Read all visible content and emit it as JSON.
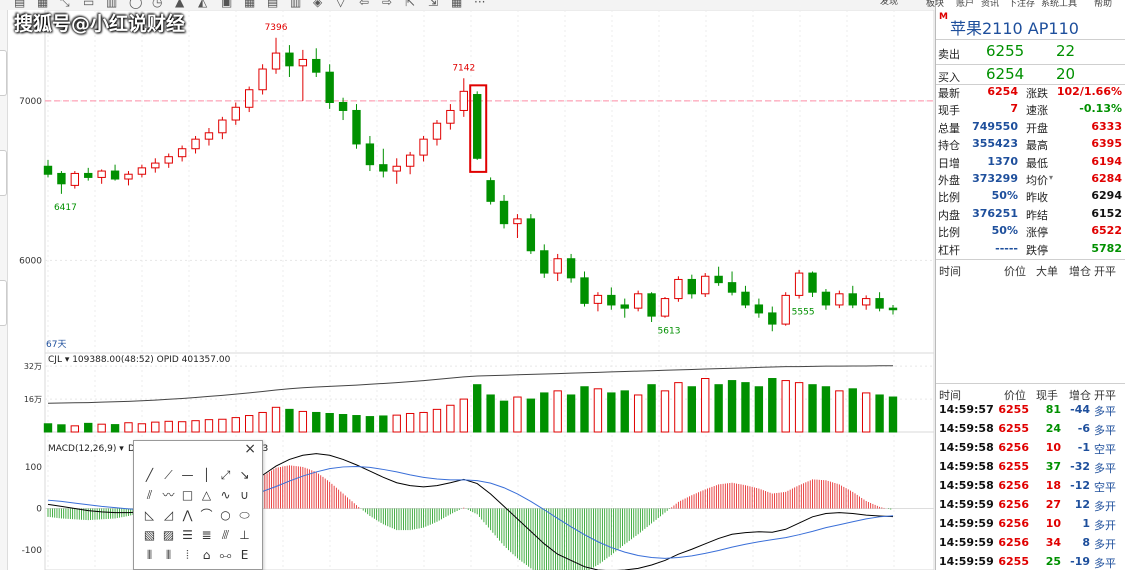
{
  "watermark": "搜狐号@小红说财经",
  "toolbar": {
    "icons": [
      "doc-icon",
      "grid-icon",
      "cursor-icon",
      "window-icon",
      "layout-icon",
      "circle-icon",
      "clock-icon",
      "chart-icon",
      "chart2-icon",
      "calendar-icon",
      "week-icon",
      "month-icon",
      "year-icon",
      "diamond-icon",
      "fold-icon",
      "back-icon",
      "forward-icon",
      "expand-icon",
      "shrink-icon",
      "table-icon",
      "more-icon"
    ],
    "more_label": "···",
    "right_label": "发现"
  },
  "chart_data": [
    {
      "type": "candlestick",
      "title": "",
      "period_label": "67天",
      "ylim": [
        5450,
        7520
      ],
      "yticks": [
        7000,
        6000
      ],
      "reference_line": 7000,
      "annotations": [
        {
          "label": "7396",
          "index": 17,
          "kind": "high"
        },
        {
          "label": "7142",
          "index": 31,
          "kind": "high"
        },
        {
          "label": "6417",
          "index": 1,
          "kind": "low"
        },
        {
          "label": "5613",
          "index": 46,
          "kind": "low"
        },
        {
          "label": "5555",
          "index": 56,
          "kind": "low"
        }
      ],
      "highlight_box_index": 32,
      "ohlc": [
        [
          6590,
          6630,
          6520,
          6540
        ],
        [
          6545,
          6560,
          6417,
          6480
        ],
        [
          6470,
          6560,
          6450,
          6545
        ],
        [
          6545,
          6580,
          6500,
          6520
        ],
        [
          6520,
          6570,
          6480,
          6560
        ],
        [
          6560,
          6600,
          6500,
          6510
        ],
        [
          6510,
          6560,
          6470,
          6540
        ],
        [
          6540,
          6600,
          6520,
          6580
        ],
        [
          6580,
          6640,
          6550,
          6610
        ],
        [
          6610,
          6670,
          6580,
          6650
        ],
        [
          6650,
          6720,
          6620,
          6700
        ],
        [
          6700,
          6780,
          6670,
          6760
        ],
        [
          6760,
          6830,
          6720,
          6800
        ],
        [
          6800,
          6900,
          6760,
          6880
        ],
        [
          6880,
          6990,
          6850,
          6960
        ],
        [
          6960,
          7090,
          6930,
          7070
        ],
        [
          7070,
          7230,
          7040,
          7200
        ],
        [
          7200,
          7396,
          7170,
          7300
        ],
        [
          7300,
          7350,
          7150,
          7220
        ],
        [
          7220,
          7320,
          7000,
          7260
        ],
        [
          7260,
          7330,
          7150,
          7180
        ],
        [
          7180,
          7230,
          6950,
          6990
        ],
        [
          6990,
          7020,
          6880,
          6940
        ],
        [
          6940,
          6980,
          6700,
          6730
        ],
        [
          6730,
          6780,
          6560,
          6600
        ],
        [
          6600,
          6700,
          6520,
          6560
        ],
        [
          6560,
          6640,
          6480,
          6590
        ],
        [
          6590,
          6680,
          6540,
          6660
        ],
        [
          6660,
          6780,
          6620,
          6760
        ],
        [
          6760,
          6880,
          6720,
          6860
        ],
        [
          6860,
          6980,
          6820,
          6940
        ],
        [
          6940,
          7142,
          6900,
          7060
        ],
        [
          7040,
          7060,
          6630,
          6640
        ],
        [
          6500,
          6520,
          6350,
          6370
        ],
        [
          6370,
          6410,
          6200,
          6230
        ],
        [
          6230,
          6290,
          6140,
          6260
        ],
        [
          6260,
          6290,
          6040,
          6060
        ],
        [
          6060,
          6100,
          5890,
          5920
        ],
        [
          5920,
          6040,
          5870,
          6010
        ],
        [
          6010,
          6040,
          5860,
          5890
        ],
        [
          5890,
          5930,
          5710,
          5730
        ],
        [
          5730,
          5800,
          5680,
          5780
        ],
        [
          5780,
          5830,
          5690,
          5720
        ],
        [
          5720,
          5760,
          5640,
          5700
        ],
        [
          5700,
          5810,
          5680,
          5790
        ],
        [
          5790,
          5800,
          5613,
          5650
        ],
        [
          5650,
          5770,
          5640,
          5760
        ],
        [
          5760,
          5900,
          5740,
          5880
        ],
        [
          5880,
          5910,
          5760,
          5790
        ],
        [
          5790,
          5920,
          5770,
          5900
        ],
        [
          5900,
          5960,
          5840,
          5860
        ],
        [
          5860,
          5930,
          5780,
          5800
        ],
        [
          5800,
          5840,
          5700,
          5720
        ],
        [
          5720,
          5760,
          5640,
          5670
        ],
        [
          5670,
          5710,
          5555,
          5600
        ],
        [
          5600,
          5800,
          5590,
          5780
        ],
        [
          5780,
          5940,
          5760,
          5920
        ],
        [
          5920,
          5930,
          5770,
          5800
        ],
        [
          5800,
          5820,
          5690,
          5720
        ],
        [
          5720,
          5810,
          5700,
          5790
        ],
        [
          5790,
          5840,
          5700,
          5720
        ],
        [
          5720,
          5780,
          5690,
          5760
        ],
        [
          5760,
          5800,
          5680,
          5700
        ],
        [
          5700,
          5720,
          5660,
          5690
        ]
      ]
    },
    {
      "type": "bar",
      "title": "",
      "series_label": "CJL",
      "readout": "109388.00(48:52)",
      "opid_readout": "OPID 401357.00",
      "yticks_labels": [
        "32万",
        "16万"
      ],
      "yticks": [
        320000,
        160000
      ],
      "ylim": [
        0,
        350000
      ],
      "values": [
        40000,
        35000,
        30000,
        42000,
        38000,
        36000,
        45000,
        40000,
        48000,
        52000,
        50000,
        55000,
        60000,
        62000,
        70000,
        80000,
        95000,
        120000,
        110000,
        100000,
        95000,
        90000,
        85000,
        80000,
        75000,
        78000,
        82000,
        90000,
        95000,
        110000,
        130000,
        160000,
        230000,
        180000,
        150000,
        170000,
        160000,
        190000,
        200000,
        180000,
        220000,
        210000,
        190000,
        200000,
        180000,
        230000,
        200000,
        240000,
        220000,
        260000,
        230000,
        250000,
        240000,
        220000,
        260000,
        250000,
        240000,
        230000,
        220000,
        200000,
        210000,
        190000,
        180000,
        170000
      ],
      "opid_line": [
        140000,
        141000,
        142000,
        143000,
        145000,
        147000,
        149000,
        152000,
        155000,
        159000,
        163000,
        168000,
        173000,
        178000,
        184000,
        190000,
        197000,
        204000,
        210000,
        215000,
        219000,
        222000,
        225000,
        228000,
        232000,
        236000,
        240000,
        245000,
        250000,
        256000,
        262000,
        268000,
        272000,
        274000,
        276000,
        278000,
        280000,
        282000,
        284000,
        286000,
        288000,
        290000,
        292000,
        294000,
        296000,
        298000,
        300000,
        302000,
        304000,
        306000,
        308000,
        310000,
        312000,
        314000,
        316000,
        318000,
        318000,
        319000,
        320000,
        320000,
        321000,
        321000,
        322000,
        322000
      ]
    },
    {
      "type": "line",
      "title": "",
      "indicator_label": "MACD(12,26,9)",
      "diff_label": "DIFF -19.47",
      "dea_label": "DEA -17.50",
      "macd_label": "-3.93",
      "ylim": [
        -160,
        160
      ],
      "yticks": [
        100,
        0,
        -100
      ],
      "series": [
        {
          "name": "DIFF",
          "values": [
            10,
            5,
            0,
            -5,
            -8,
            -10,
            -10,
            -8,
            -5,
            0,
            8,
            16,
            25,
            35,
            48,
            62,
            80,
            102,
            118,
            128,
            132,
            128,
            118,
            105,
            90,
            75,
            62,
            55,
            52,
            55,
            62,
            70,
            60,
            35,
            5,
            -25,
            -55,
            -85,
            -110,
            -125,
            -140,
            -148,
            -150,
            -148,
            -144,
            -136,
            -125,
            -110,
            -98,
            -85,
            -72,
            -62,
            -58,
            -56,
            -57,
            -50,
            -35,
            -20,
            -12,
            -10,
            -12,
            -16,
            -18,
            -19.47
          ]
        },
        {
          "name": "DEA",
          "values": [
            20,
            17,
            13,
            9,
            5,
            2,
            -1,
            -3,
            -4,
            -3,
            -1,
            2,
            7,
            13,
            21,
            30,
            41,
            53,
            66,
            78,
            88,
            96,
            100,
            101,
            99,
            94,
            88,
            81,
            75,
            71,
            69,
            69,
            67,
            61,
            50,
            35,
            17,
            -3,
            -24,
            -44,
            -63,
            -80,
            -94,
            -105,
            -113,
            -118,
            -120,
            -118,
            -114,
            -108,
            -101,
            -93,
            -86,
            -80,
            -75,
            -70,
            -63,
            -55,
            -46,
            -39,
            -32,
            -25,
            -20,
            -17.5
          ]
        },
        {
          "name": "MACD",
          "values": [
            -20,
            -24,
            -26,
            -28,
            -26,
            -24,
            -18,
            -10,
            -2,
            6,
            18,
            28,
            36,
            44,
            54,
            64,
            78,
            98,
            104,
            100,
            88,
            64,
            36,
            8,
            -18,
            -38,
            -52,
            -52,
            -46,
            -32,
            -14,
            2,
            -14,
            -52,
            -90,
            -120,
            -144,
            -164,
            -172,
            -162,
            -154,
            -136,
            -112,
            -86,
            -62,
            -36,
            -10,
            16,
            32,
            46,
            58,
            62,
            56,
            48,
            36,
            40,
            56,
            70,
            68,
            58,
            40,
            18,
            4,
            -3.93
          ]
        }
      ]
    }
  ],
  "draw_palette": {
    "close_label": "×",
    "tools": [
      "╱",
      "⟋",
      "—",
      "│",
      "⤢",
      "↘",
      "⫽",
      "〰",
      "□",
      "△",
      "∿",
      "∪",
      "◺",
      "◿",
      "⋀",
      "⌒",
      "○",
      "⬭",
      "▧",
      "▨",
      "☰",
      "≣",
      "⫻",
      "⊥",
      "⦀",
      "⫴",
      "⦙",
      "⌂",
      "⧟",
      "Ε",
      "■",
      "◆"
    ]
  },
  "quote": {
    "top_menu": [
      "板块",
      "账户",
      "资讯",
      "下注存",
      "系统工具",
      "帮助"
    ],
    "m_badge": "M",
    "title": "苹果2110  AP110",
    "sell_label": "卖出",
    "sell_price": "6255",
    "sell_vol": "22",
    "buy_label": "买入",
    "buy_price": "6254",
    "buy_vol": "20",
    "stats": [
      {
        "l1": "最新",
        "v1": "6254",
        "c1": "red",
        "l2": "涨跌",
        "v2": "102/1.66%",
        "c2": "red"
      },
      {
        "l1": "现手",
        "v1": "7",
        "c1": "red",
        "l2": "速涨",
        "v2": "-0.13%",
        "c2": "green"
      },
      {
        "l1": "总量",
        "v1": "749550",
        "c1": "blue",
        "l2": "开盘",
        "v2": "6333",
        "c2": "red"
      },
      {
        "l1": "持仓",
        "v1": "355423",
        "c1": "blue",
        "l2": "最高",
        "v2": "6395",
        "c2": "red"
      },
      {
        "l1": "日增",
        "v1": "1370",
        "c1": "blue",
        "l2": "最低",
        "v2": "6194",
        "c2": "red"
      },
      {
        "l1": "外盘",
        "v1": "373299",
        "c1": "blue",
        "l2": "均价",
        "v2": "6284",
        "c2": "red"
      },
      {
        "l1": "比例",
        "v1": "50%",
        "c1": "blue",
        "l2": "昨收",
        "v2": "6294",
        "c2": "black"
      },
      {
        "l1": "内盘",
        "v1": "376251",
        "c1": "blue",
        "l2": "昨结",
        "v2": "6152",
        "c2": "black"
      },
      {
        "l1": "比例",
        "v1": "50%",
        "c1": "blue",
        "l2": "涨停",
        "v2": "6522",
        "c2": "red"
      },
      {
        "l1": "杠杆",
        "v1": "-----",
        "c1": "blue",
        "l2": "跌停",
        "v2": "5782",
        "c2": "green"
      }
    ],
    "sort_arrow": "▾",
    "headers1": [
      "时间",
      "价位",
      "大单",
      "增仓",
      "开平"
    ],
    "headers2": [
      "时间",
      "价位",
      "现手",
      "增仓",
      "开平"
    ],
    "trades": [
      {
        "time": "14:59:57",
        "price": "6255",
        "vol": "81",
        "vc": "green",
        "chg": "-44",
        "cc": "blue",
        "type": "多平"
      },
      {
        "time": "14:59:58",
        "price": "6255",
        "vol": "24",
        "vc": "green",
        "chg": "-6",
        "cc": "blue",
        "type": "多平"
      },
      {
        "time": "14:59:58",
        "price": "6256",
        "vol": "10",
        "vc": "red",
        "chg": "-1",
        "cc": "blue",
        "type": "空平"
      },
      {
        "time": "14:59:58",
        "price": "6255",
        "vol": "37",
        "vc": "green",
        "chg": "-32",
        "cc": "blue",
        "type": "多平"
      },
      {
        "time": "14:59:58",
        "price": "6256",
        "vol": "18",
        "vc": "red",
        "chg": "-12",
        "cc": "blue",
        "type": "空平"
      },
      {
        "time": "14:59:59",
        "price": "6256",
        "vol": "27",
        "vc": "red",
        "chg": "12",
        "cc": "blue",
        "type": "多开"
      },
      {
        "time": "14:59:59",
        "price": "6256",
        "vol": "10",
        "vc": "red",
        "chg": "1",
        "cc": "blue",
        "type": "多开"
      },
      {
        "time": "14:59:59",
        "price": "6256",
        "vol": "34",
        "vc": "red",
        "chg": "8",
        "cc": "blue",
        "type": "多开"
      },
      {
        "time": "14:59:59",
        "price": "6255",
        "vol": "25",
        "vc": "green",
        "chg": "-19",
        "cc": "blue",
        "type": "多平"
      }
    ]
  },
  "colors": {
    "up": "#e00000",
    "down": "#009000",
    "accent": "#1e4f9c",
    "ref_line": "#ff8fa8",
    "diff_line": "#000000",
    "dea_line": "#3a6fd8",
    "highlight": "#e00000"
  }
}
